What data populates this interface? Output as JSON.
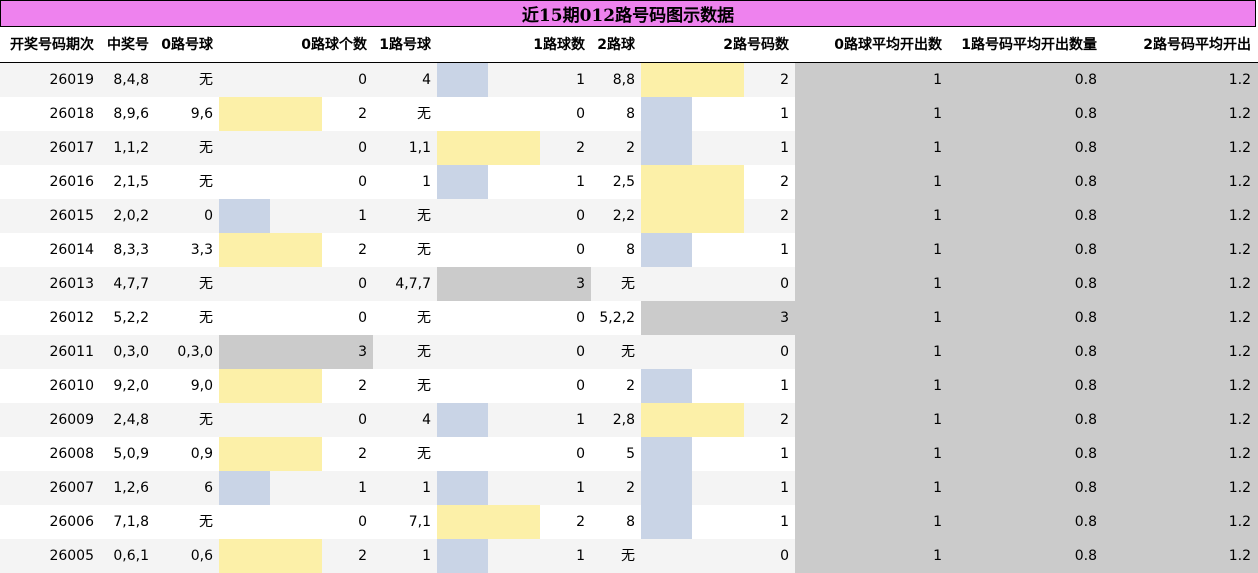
{
  "title": "近15期012路号码图示数据",
  "colors": {
    "title_bg": "#ee82ee",
    "count1_bar": "#c9d4e6",
    "count2_bar": "#fcf0a8",
    "count3_bar": "#cbcbcb",
    "avg_bg": "#cbcbcb",
    "row_alt": "#f4f4f4"
  },
  "chart_data": {
    "type": "table",
    "title": "近15期012路号码图示数据",
    "columns": [
      "开奖号码期次",
      "中奖号",
      "0路号球",
      "0路球个数",
      "1路号球",
      "1路球数",
      "2路球",
      "2路号码数",
      "0路球平均开出数",
      "1路号码平均开出数量",
      "2路号码平均开出"
    ],
    "bar_max": 3,
    "rows": [
      {
        "period": "26019",
        "draw": "8,4,8",
        "road0": "无",
        "road0_count": 0,
        "road1": "4",
        "road1_count": 1,
        "road2": "8,8",
        "road2_count": 2,
        "avg0": "1",
        "avg1": "0.8",
        "avg2": "1.2"
      },
      {
        "period": "26018",
        "draw": "8,9,6",
        "road0": "9,6",
        "road0_count": 2,
        "road1": "无",
        "road1_count": 0,
        "road2": "8",
        "road2_count": 1,
        "avg0": "1",
        "avg1": "0.8",
        "avg2": "1.2"
      },
      {
        "period": "26017",
        "draw": "1,1,2",
        "road0": "无",
        "road0_count": 0,
        "road1": "1,1",
        "road1_count": 2,
        "road2": "2",
        "road2_count": 1,
        "avg0": "1",
        "avg1": "0.8",
        "avg2": "1.2"
      },
      {
        "period": "26016",
        "draw": "2,1,5",
        "road0": "无",
        "road0_count": 0,
        "road1": "1",
        "road1_count": 1,
        "road2": "2,5",
        "road2_count": 2,
        "avg0": "1",
        "avg1": "0.8",
        "avg2": "1.2"
      },
      {
        "period": "26015",
        "draw": "2,0,2",
        "road0": "0",
        "road0_count": 1,
        "road1": "无",
        "road1_count": 0,
        "road2": "2,2",
        "road2_count": 2,
        "avg0": "1",
        "avg1": "0.8",
        "avg2": "1.2"
      },
      {
        "period": "26014",
        "draw": "8,3,3",
        "road0": "3,3",
        "road0_count": 2,
        "road1": "无",
        "road1_count": 0,
        "road2": "8",
        "road2_count": 1,
        "avg0": "1",
        "avg1": "0.8",
        "avg2": "1.2"
      },
      {
        "period": "26013",
        "draw": "4,7,7",
        "road0": "无",
        "road0_count": 0,
        "road1": "4,7,7",
        "road1_count": 3,
        "road2": "无",
        "road2_count": 0,
        "avg0": "1",
        "avg1": "0.8",
        "avg2": "1.2"
      },
      {
        "period": "26012",
        "draw": "5,2,2",
        "road0": "无",
        "road0_count": 0,
        "road1": "无",
        "road1_count": 0,
        "road2": "5,2,2",
        "road2_count": 3,
        "avg0": "1",
        "avg1": "0.8",
        "avg2": "1.2"
      },
      {
        "period": "26011",
        "draw": "0,3,0",
        "road0": "0,3,0",
        "road0_count": 3,
        "road1": "无",
        "road1_count": 0,
        "road2": "无",
        "road2_count": 0,
        "avg0": "1",
        "avg1": "0.8",
        "avg2": "1.2"
      },
      {
        "period": "26010",
        "draw": "9,2,0",
        "road0": "9,0",
        "road0_count": 2,
        "road1": "无",
        "road1_count": 0,
        "road2": "2",
        "road2_count": 1,
        "avg0": "1",
        "avg1": "0.8",
        "avg2": "1.2"
      },
      {
        "period": "26009",
        "draw": "2,4,8",
        "road0": "无",
        "road0_count": 0,
        "road1": "4",
        "road1_count": 1,
        "road2": "2,8",
        "road2_count": 2,
        "avg0": "1",
        "avg1": "0.8",
        "avg2": "1.2"
      },
      {
        "period": "26008",
        "draw": "5,0,9",
        "road0": "0,9",
        "road0_count": 2,
        "road1": "无",
        "road1_count": 0,
        "road2": "5",
        "road2_count": 1,
        "avg0": "1",
        "avg1": "0.8",
        "avg2": "1.2"
      },
      {
        "period": "26007",
        "draw": "1,2,6",
        "road0": "6",
        "road0_count": 1,
        "road1": "1",
        "road1_count": 1,
        "road2": "2",
        "road2_count": 1,
        "avg0": "1",
        "avg1": "0.8",
        "avg2": "1.2"
      },
      {
        "period": "26006",
        "draw": "7,1,8",
        "road0": "无",
        "road0_count": 0,
        "road1": "7,1",
        "road1_count": 2,
        "road2": "8",
        "road2_count": 1,
        "avg0": "1",
        "avg1": "0.8",
        "avg2": "1.2"
      },
      {
        "period": "26005",
        "draw": "0,6,1",
        "road0": "0,6",
        "road0_count": 2,
        "road1": "1",
        "road1_count": 1,
        "road2": "无",
        "road2_count": 0,
        "avg0": "1",
        "avg1": "0.8",
        "avg2": "1.2"
      }
    ]
  }
}
